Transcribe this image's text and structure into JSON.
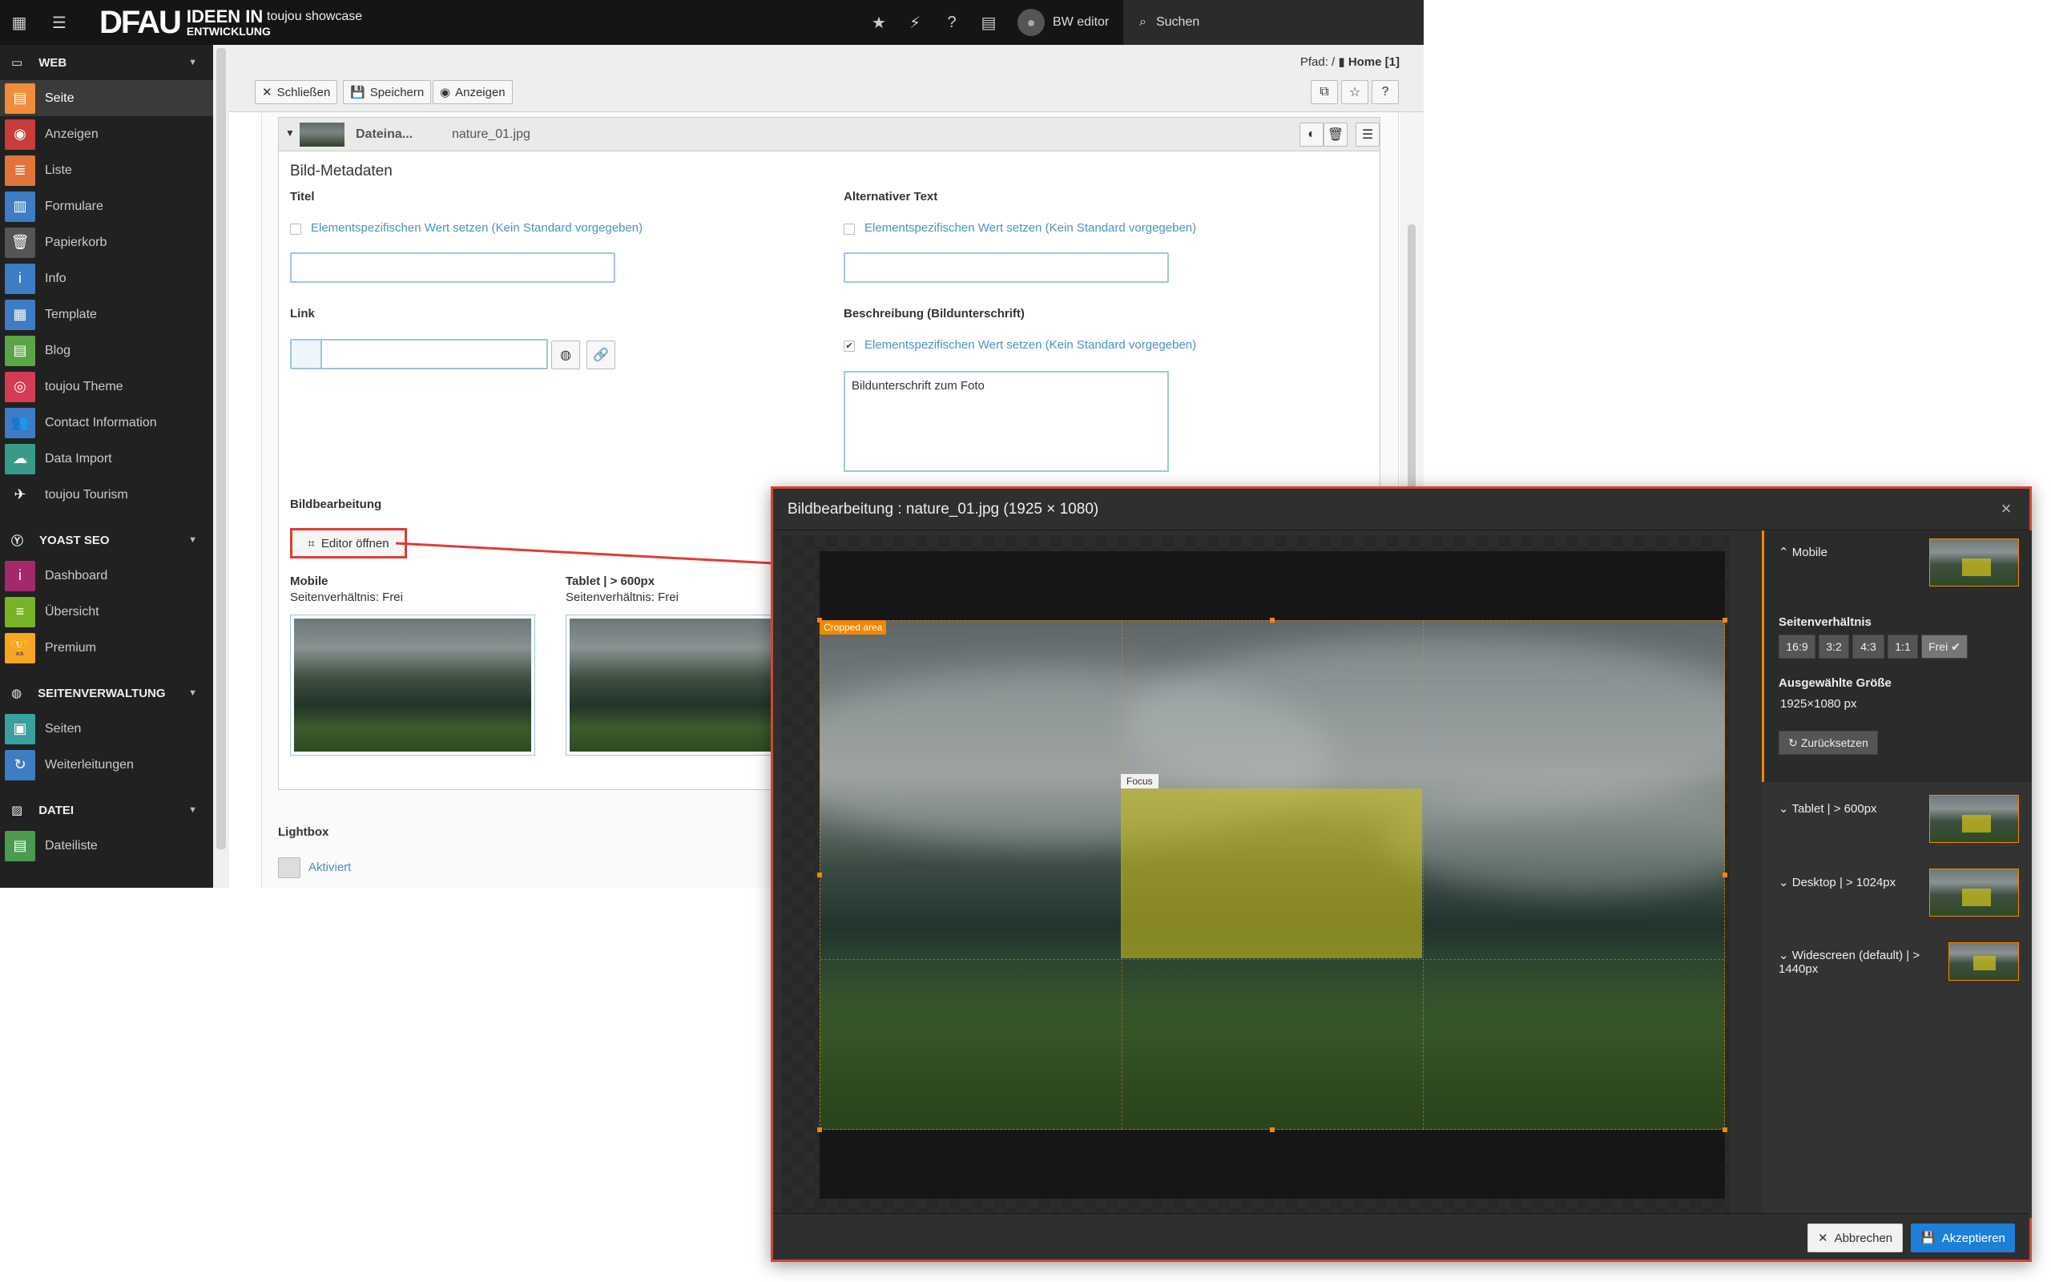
{
  "topbar": {
    "site_name": "toujou showcase",
    "logo_text": "DFAU",
    "logo_line1": "IDEEN IN",
    "logo_line2": "ENTWICKLUNG",
    "user": "BW editor",
    "search": "Suchen"
  },
  "sidebar": {
    "groups": [
      {
        "title": "WEB",
        "items": [
          "Seite",
          "Anzeigen",
          "Liste",
          "Formulare",
          "Papierkorb",
          "Info",
          "Template",
          "Blog",
          "toujou Theme",
          "Contact Information",
          "Data Import",
          "toujou Tourism"
        ]
      },
      {
        "title": "YOAST SEO",
        "items": [
          "Dashboard",
          "Übersicht",
          "Premium"
        ]
      },
      {
        "title": "SEITENVERWALTUNG",
        "items": [
          "Seiten",
          "Weiterleitungen"
        ]
      },
      {
        "title": "DATEI",
        "items": [
          "Dateiliste"
        ]
      }
    ]
  },
  "docheader": {
    "close": "Schließen",
    "save": "Speichern",
    "view": "Anzeigen",
    "path_label": "Pfad: /",
    "path_page": "Home [1]",
    "help": "?"
  },
  "panel": {
    "field_label": "Dateina...",
    "filename": "nature_01.jpg",
    "section": "Bild-Metadaten",
    "title_label": "Titel",
    "alt_label": "Alternativer Text",
    "override_text": "Elementspezifischen Wert setzen (Kein Standard vorgegeben)",
    "link_label": "Link",
    "desc_label": "Beschreibung (Bildunterschrift)",
    "caption_value": "Bildunterschrift zum Foto",
    "edit_label": "Bildbearbeitung",
    "editor_button": "Editor öffnen",
    "mobile_label": "Mobile",
    "tablet_label": "Tablet | > 600px",
    "ratio_text": "Seitenverhältnis: Frei",
    "lightbox_label": "Lightbox",
    "lightbox_value": "Aktiviert"
  },
  "modal": {
    "title": "Bildbearbeitung : nature_01.jpg (1925 × 1080)",
    "cropped_area": "Cropped area",
    "focus": "Focus",
    "variants": [
      "Mobile",
      "Tablet | > 600px",
      "Desktop | > 1024px",
      "Widescreen (default) | > 1440px"
    ],
    "ratio_heading": "Seitenverhältnis",
    "ratios": [
      "16:9",
      "3:2",
      "4:3",
      "1:1",
      "Frei"
    ],
    "size_heading": "Ausgewählte Größe",
    "size_value": "1925×1080 px",
    "reset": "Zurücksetzen",
    "cancel": "Abbrechen",
    "accept": "Akzeptieren"
  },
  "colors": {
    "accent": "#f08800",
    "primary_button": "#1e7fd8",
    "highlight_border": "#e03c31",
    "sidebar_bg": "#212121"
  }
}
